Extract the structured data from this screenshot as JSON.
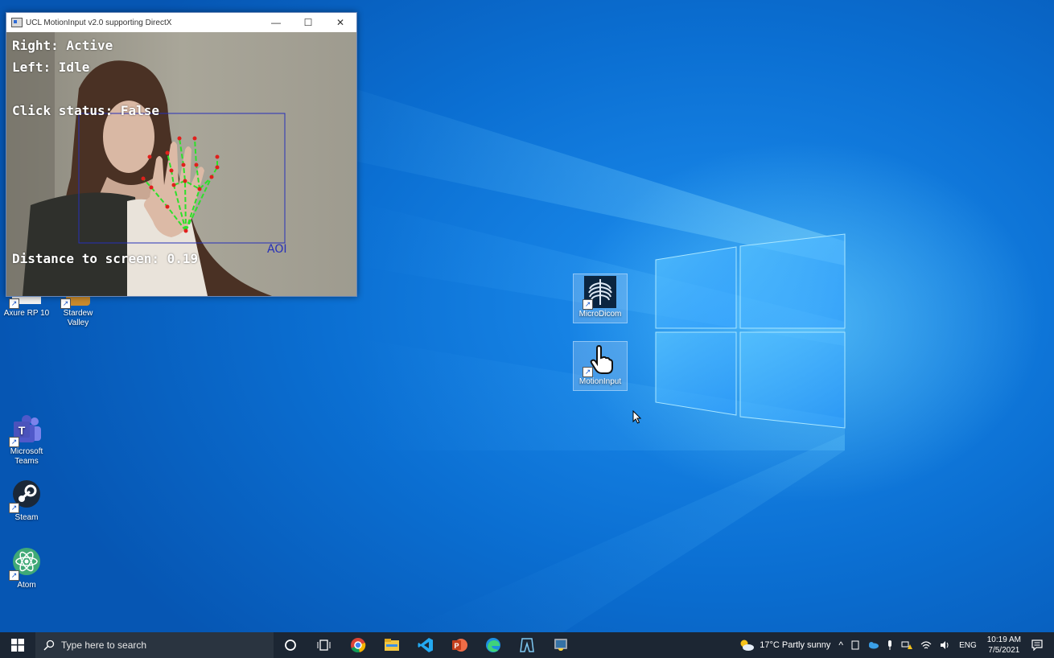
{
  "camera_window": {
    "title": "UCL MotionInput v2.0 supporting DirectX",
    "controls": {
      "minimize": "—",
      "maximize": "☐",
      "close": "✕"
    },
    "overlay": {
      "right_status": "Right: Active",
      "left_status": "Left: Idle",
      "click_status": "Click status: False",
      "aoi_label": "AOI",
      "distance": "Distance to screen: 0.19"
    }
  },
  "desktop_icons": [
    {
      "label": "Axure RP 10",
      "icon": "axure-icon"
    },
    {
      "label": "Stardew Valley",
      "icon": "stardew-icon"
    },
    {
      "label": "Microsoft Teams",
      "icon": "teams-icon"
    },
    {
      "label": "Steam",
      "icon": "steam-icon"
    },
    {
      "label": "Atom",
      "icon": "atom-icon"
    },
    {
      "label": "MicroDicom",
      "icon": "xray-icon"
    },
    {
      "label": "MotionInput",
      "icon": "hand-pointer-icon"
    }
  ],
  "taskbar": {
    "search_placeholder": "Type here to search",
    "pinned": [
      "cortana-icon",
      "task-view-icon",
      "chrome-icon",
      "file-explorer-icon",
      "vscode-icon",
      "powerpoint-icon",
      "edge-icon",
      "unity-icon",
      "python-icon"
    ],
    "weather": "17°C  Partly sunny",
    "language": "ENG",
    "time": "10:19 AM",
    "date": "7/5/2021"
  },
  "colors": {
    "taskbar_bg": "#1c2633",
    "wallpaper_blue": "#0b6fd2",
    "landmark_red": "#e0201c",
    "skeleton_green": "#2de02a",
    "aoi_blue": "#2730b8"
  }
}
